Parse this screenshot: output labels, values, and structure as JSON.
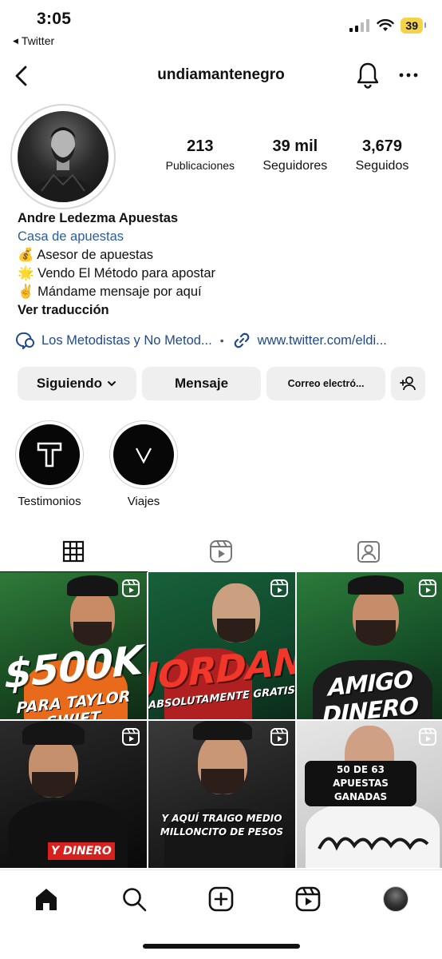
{
  "status_bar": {
    "time": "3:05",
    "back_app": "Twitter",
    "battery": "39"
  },
  "header": {
    "username": "undiamantenegro"
  },
  "profile": {
    "stats": [
      {
        "value": "213",
        "label": "Publicaciones"
      },
      {
        "value": "39 mil",
        "label": "Seguidores"
      },
      {
        "value": "3,679",
        "label": "Seguidos"
      }
    ],
    "name": "Andre Ledezma Apuestas",
    "category": "Casa de apuestas",
    "bio_lines": [
      "💰 Asesor de apuestas",
      "🌟 Vendo El Método para apostar",
      "✌️ Mándame mensaje por aquí"
    ],
    "translate": "Ver traducción",
    "links": {
      "channel": "Los Metodistas y No Metod...",
      "website": "www.twitter.com/eldi..."
    }
  },
  "actions": {
    "following": "Siguiendo",
    "message": "Mensaje",
    "email": "Correo electró..."
  },
  "highlights": [
    {
      "letter": "T",
      "label": "Testimonios"
    },
    {
      "letter": "V",
      "label": "Viajes"
    }
  ],
  "posts": [
    {
      "caption": "$500K",
      "subcaption": "PARA TAYLOR SWIFT"
    },
    {
      "caption": "JORDAN",
      "subcaption": "ABSOLUTAMENTE GRATIS"
    },
    {
      "caption": "AMIGO DINERO",
      "subcaption": ""
    },
    {
      "caption": "Y DINERO",
      "subcaption": ""
    },
    {
      "caption": "Y AQUÍ TRAIGO MEDIO",
      "subcaption": "MILLONCITO DE PESOS"
    },
    {
      "caption": "50 DE 63 APUESTAS",
      "subcaption": "GANADAS"
    }
  ],
  "colors": {
    "link": "#22488c",
    "category": "#2b5d9e",
    "button_bg": "#efefef"
  }
}
